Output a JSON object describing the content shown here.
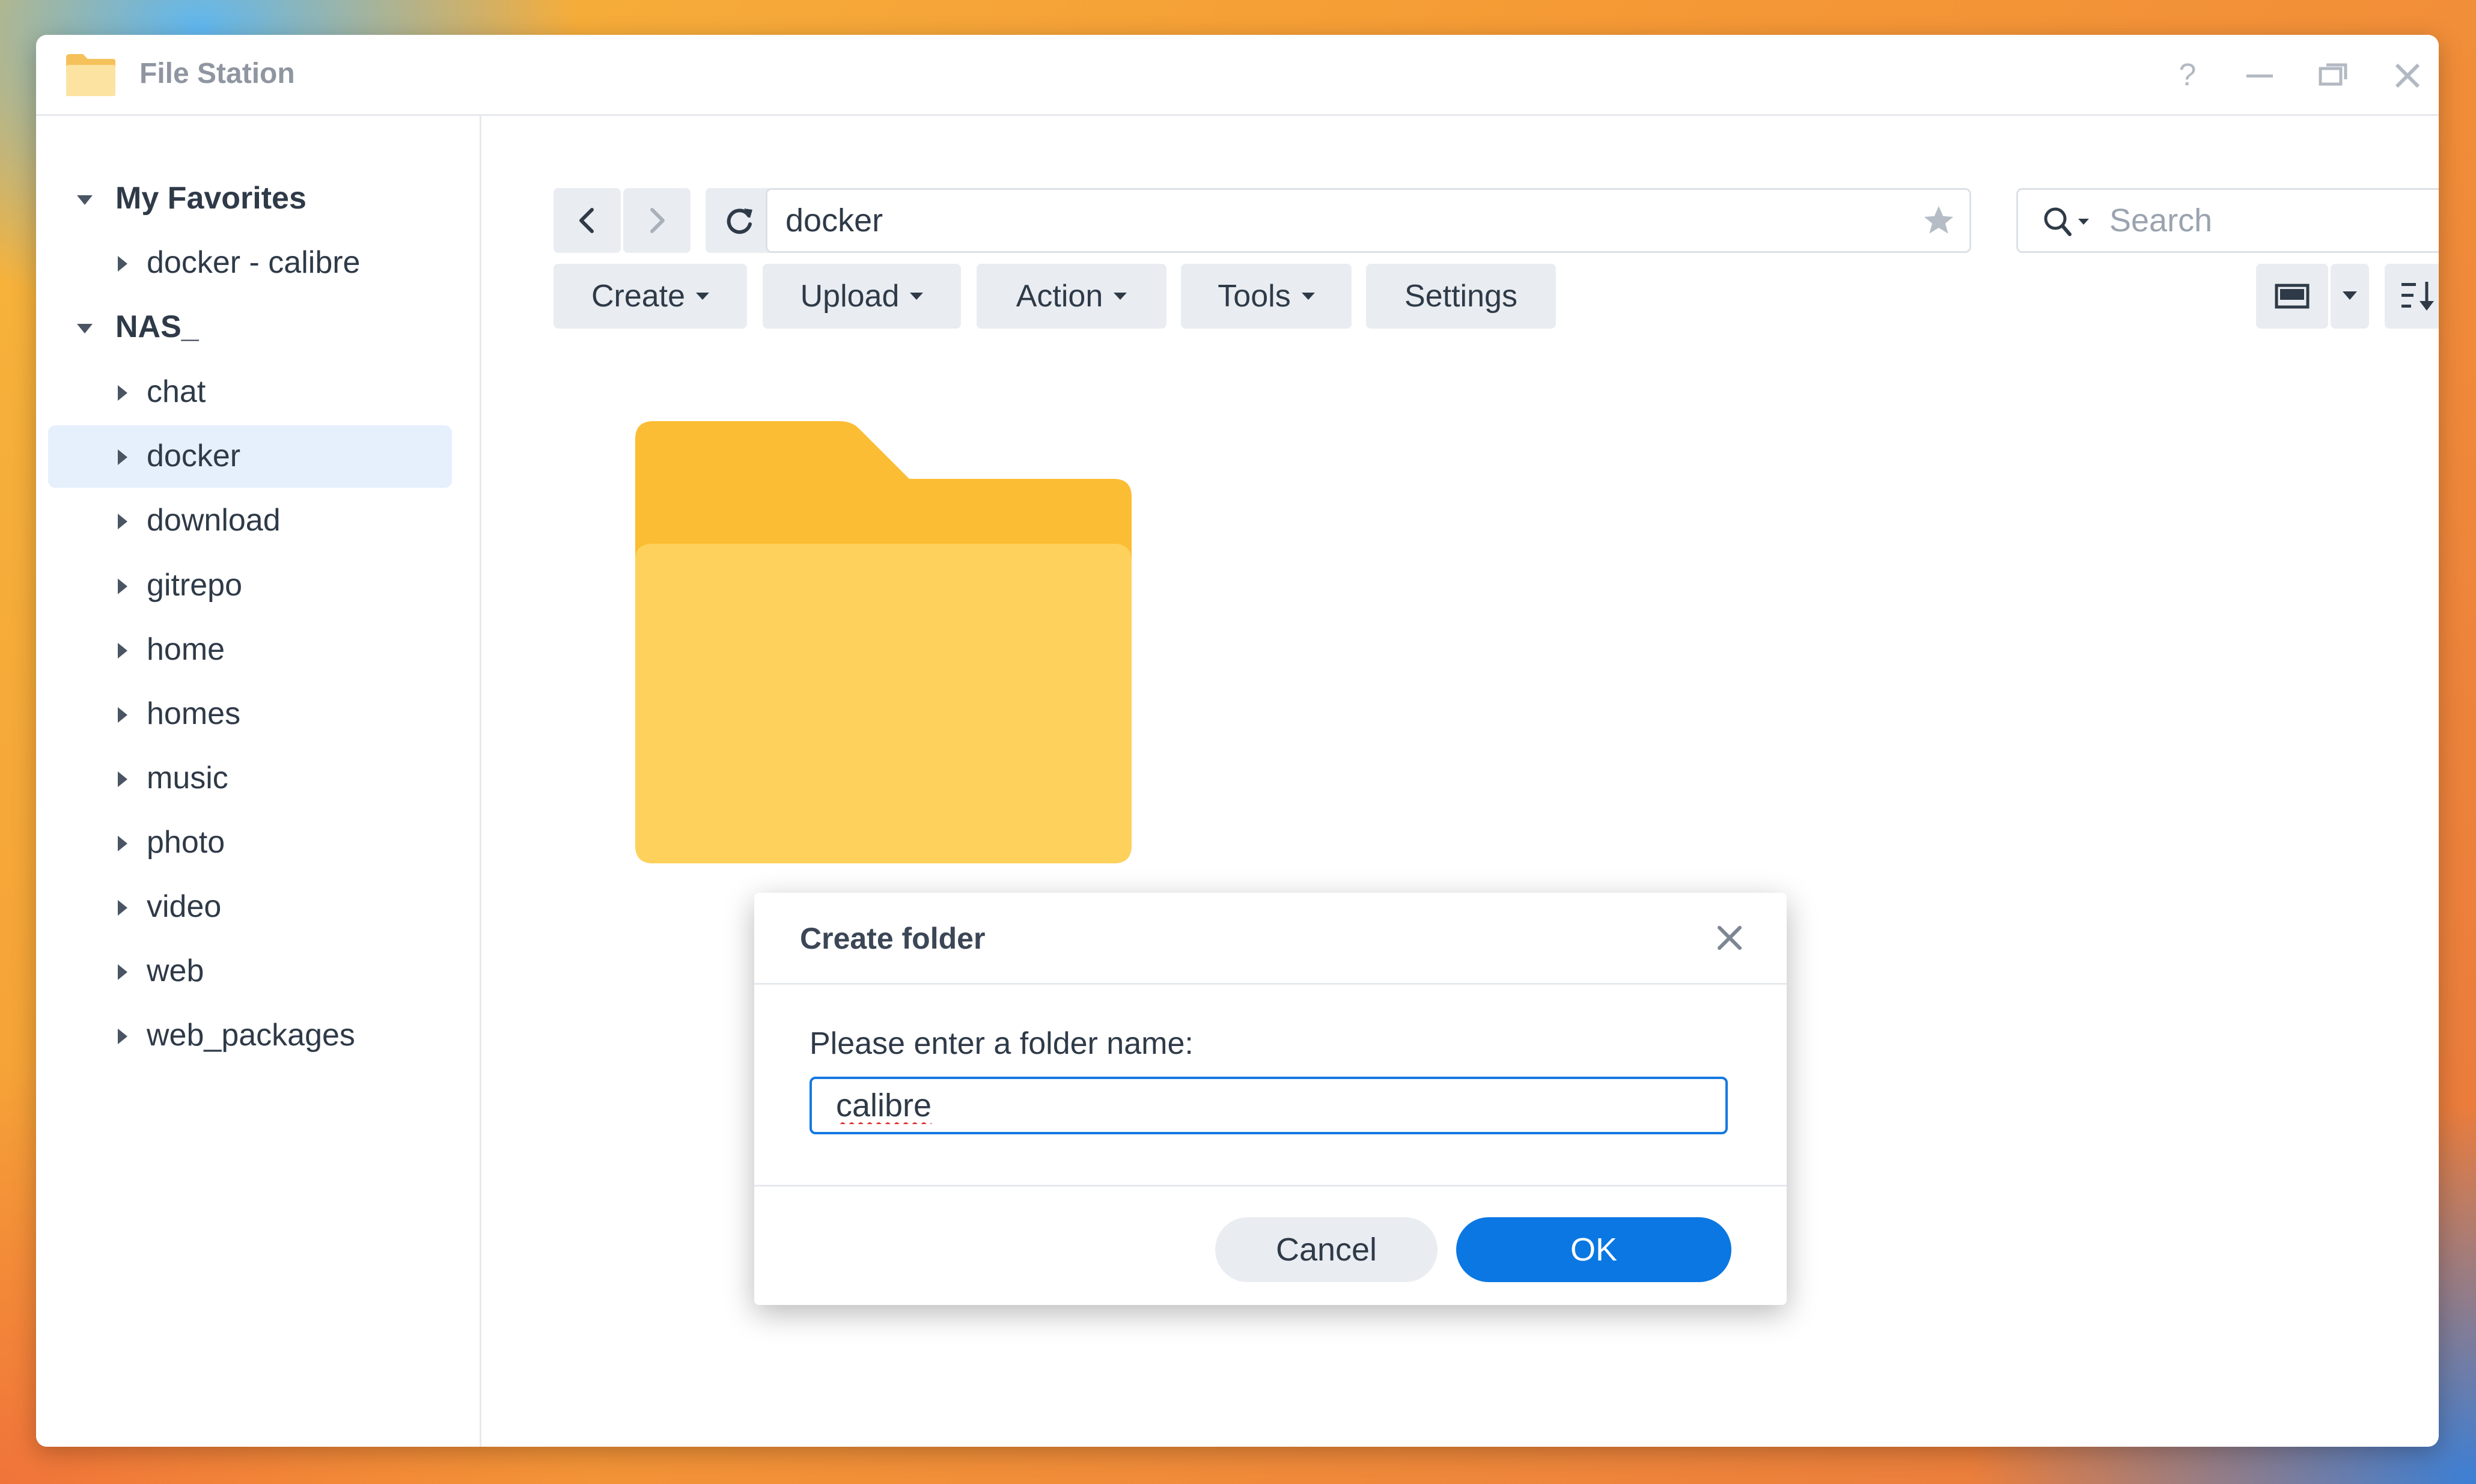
{
  "window": {
    "title": "File Station",
    "icon": "folder-app-icon",
    "controls": [
      "help-icon",
      "minimize-icon",
      "restore-icon",
      "close-icon"
    ]
  },
  "sidebar": {
    "favorites": {
      "label": "My Favorites",
      "items": [
        {
          "label": "docker - calibre"
        }
      ]
    },
    "nas": {
      "label": "NAS_",
      "items": [
        {
          "label": "chat"
        },
        {
          "label": "docker",
          "selected": true
        },
        {
          "label": "download"
        },
        {
          "label": "gitrepo"
        },
        {
          "label": "home"
        },
        {
          "label": "homes"
        },
        {
          "label": "music"
        },
        {
          "label": "photo"
        },
        {
          "label": "video"
        },
        {
          "label": "web"
        },
        {
          "label": "web_packages"
        }
      ]
    }
  },
  "toolbar": {
    "path": "docker",
    "search_placeholder": "Search",
    "create_label": "Create",
    "upload_label": "Upload",
    "action_label": "Action",
    "tools_label": "Tools",
    "settings_label": "Settings"
  },
  "dialog": {
    "title": "Create folder",
    "prompt": "Please enter a folder name:",
    "input_value": "calibre",
    "cancel_label": "Cancel",
    "ok_label": "OK"
  },
  "colors": {
    "accent": "#0b77e3",
    "selected_row": "#e6effc",
    "folder_back": "#fbbd33",
    "folder_front": "#fed15c"
  }
}
